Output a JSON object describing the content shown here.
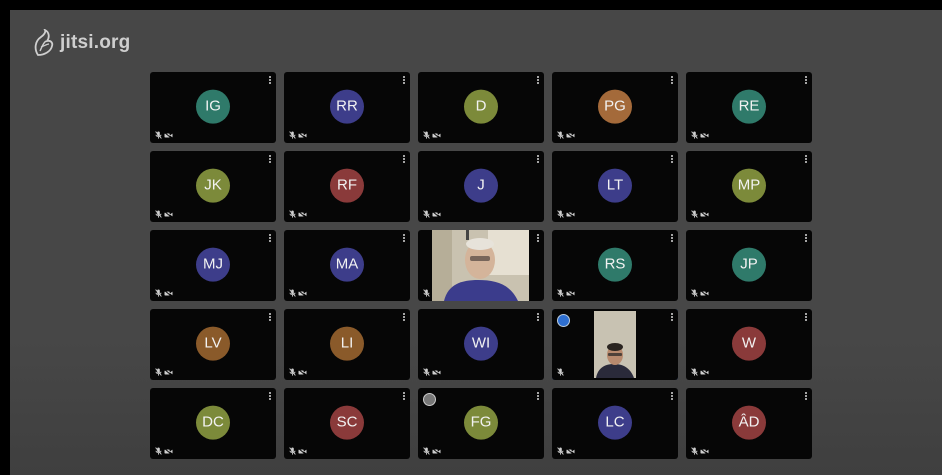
{
  "app": {
    "logo_text": "jitsi.org"
  },
  "participants": [
    {
      "initials": "IG",
      "color": "#2f7a6a"
    },
    {
      "initials": "RR",
      "color": "#3d3d8a"
    },
    {
      "initials": "D",
      "color": "#7c8a3a"
    },
    {
      "initials": "PG",
      "color": "#a46a3a"
    },
    {
      "initials": "RE",
      "color": "#2f7a6a"
    },
    {
      "initials": "JK",
      "color": "#7c8a3a"
    },
    {
      "initials": "RF",
      "color": "#8a3a3a"
    },
    {
      "initials": "J",
      "color": "#3d3d8a"
    },
    {
      "initials": "LT",
      "color": "#3d3d8a"
    },
    {
      "initials": "MP",
      "color": "#7c8a3a"
    },
    {
      "initials": "MJ",
      "color": "#3d3d8a"
    },
    {
      "initials": "MA",
      "color": "#3d3d8a"
    },
    {
      "initials": "",
      "video": true
    },
    {
      "initials": "RS",
      "color": "#2f7a6a"
    },
    {
      "initials": "JP",
      "color": "#2f7a6a"
    },
    {
      "initials": "LV",
      "color": "#8a5a2a"
    },
    {
      "initials": "LI",
      "color": "#8a5a2a"
    },
    {
      "initials": "WI",
      "color": "#3d3d8a"
    },
    {
      "initials": "",
      "video": true,
      "active": true
    },
    {
      "initials": "W",
      "color": "#8a3a3a"
    },
    {
      "initials": "DC",
      "color": "#7c8a3a"
    },
    {
      "initials": "SC",
      "color": "#8a3a3a"
    },
    {
      "initials": "FG",
      "color": "#7c8a3a"
    },
    {
      "initials": "LC",
      "color": "#3d3d8a"
    },
    {
      "initials": "ÂD",
      "color": "#8a3a3a"
    }
  ]
}
